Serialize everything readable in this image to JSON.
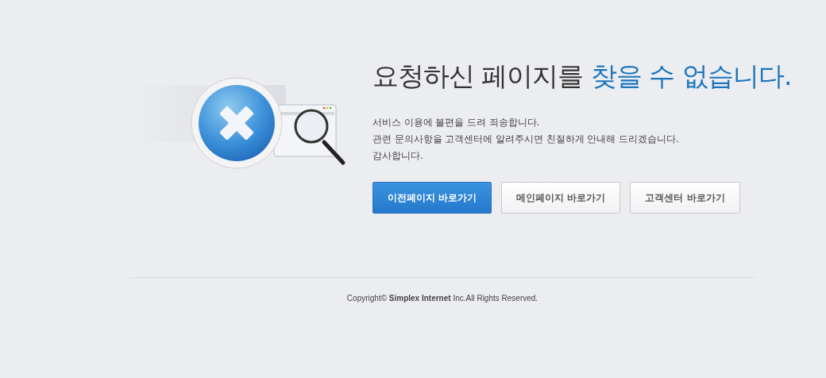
{
  "heading": {
    "text": "요청하신 페이지를",
    "highlight": "찾을 수 없습니다."
  },
  "message_lines": [
    "서비스 이용에 불편을 드려 죄송합니다.",
    "관련 문의사항을 고객센터에 알려주시면 친절하게 안내해 드리겠습니다.",
    "감사합니다."
  ],
  "buttons": [
    {
      "label": "이전페이지 바로가기",
      "kind": "primary"
    },
    {
      "label": "메인페이지 바로가기",
      "kind": "default"
    },
    {
      "label": "고객센터 바로가기",
      "kind": "default"
    }
  ],
  "footer": {
    "copyright": "Copyright© **Simplex Internet** Inc.All Rights Reserved."
  }
}
